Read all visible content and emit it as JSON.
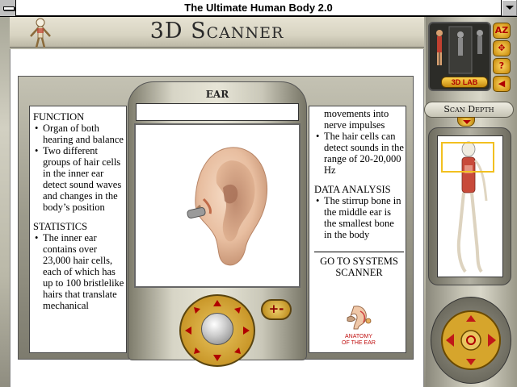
{
  "window": {
    "title": "The Ultimate Human Body 2.0"
  },
  "header": {
    "title": "3D Scanner"
  },
  "viewer": {
    "label": "EAR",
    "name_field_value": ""
  },
  "left_text": {
    "function_heading": "FUNCTION",
    "function_items": [
      "Organ of both hearing and balance",
      "Two different groups of hair cells in the inner ear detect sound waves and changes in the body’s position"
    ],
    "statistics_heading": "STATISTICS",
    "statistics_items": [
      "The inner ear contains over 23,000 hair cells, each of which has up to 100 bristlelike hairs that translate mechanical"
    ]
  },
  "right_text": {
    "continued": "movements into nerve impulses",
    "items": [
      "The hair cells can detect sounds in the range of 20-20,000 Hz"
    ],
    "analysis_heading": "DATA ANALYSIS",
    "analysis_items": [
      "The stirrup bone in the middle ear is the smallest bone in the body"
    ],
    "goto_systems_line1": "GO TO SYSTEMS",
    "goto_systems_line2": "SCANNER",
    "anatomy_line1": "ANATOMY",
    "anatomy_line2": "OF THE EAR"
  },
  "controls": {
    "zoom_label": "+-"
  },
  "sidebar": {
    "lab_label": "3D LAB",
    "btn_az": "AZ",
    "btn_question": "?",
    "scan_depth_label": "Scan Depth"
  },
  "colors": {
    "accent_gold": "#d09517",
    "accent_red": "#b00000",
    "metal": "#c4c2b3"
  }
}
